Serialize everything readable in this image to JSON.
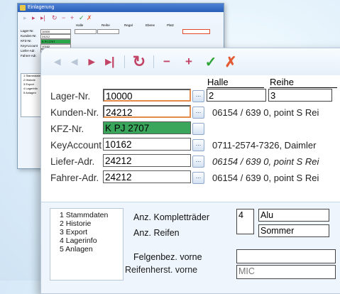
{
  "back_window": {
    "title": "Einlagerung",
    "column_headers": [
      "Halle",
      "Reihe",
      "Regal",
      "Ebene",
      "Platz"
    ],
    "labels": [
      "Lager-Nr.",
      "Kunden-Nr.",
      "KFZ-Nr.",
      "KeyAccount",
      "Liefer-Adr.",
      "Fahrer-Adr."
    ],
    "values": [
      "10000",
      "24212",
      "K PJ 2707",
      "10162",
      "24212",
      "24212"
    ],
    "nav": [
      "1 Stammdaten",
      "2 Historie",
      "3 Export",
      "4 Lagerinfo",
      "5 Anlagen"
    ]
  },
  "toolbar": {
    "icons": [
      "first-icon",
      "prev-icon",
      "next-icon",
      "last-icon",
      "refresh-icon",
      "delete-icon",
      "add-icon",
      "save-icon",
      "cancel-icon"
    ]
  },
  "form": {
    "headers": {
      "halle": "Halle",
      "reihe": "Reihe"
    },
    "rows": [
      {
        "label": "Lager-Nr.",
        "value": "10000",
        "info": ""
      },
      {
        "label": "Kunden-Nr.",
        "value": "24212",
        "info": "06154 / 639 0, point S Rei"
      },
      {
        "label": "KFZ-Nr.",
        "value": "K PJ 2707",
        "info": ""
      },
      {
        "label": "KeyAccount",
        "value": "10162",
        "info": "0711-2574-7326, Daimler"
      },
      {
        "label": "Liefer-Adr.",
        "value": "24212",
        "info": "06154 / 639 0, point S Rei"
      },
      {
        "label": "Fahrer-Adr.",
        "value": "24212",
        "info": "06154 / 639 0, point S Rei"
      }
    ],
    "halle_value": "2",
    "reihe_value": "3",
    "lookup_glyph": "..."
  },
  "bottom": {
    "nav": [
      "1 Stammdaten",
      "2 Historie",
      "3 Export",
      "4 Lagerinfo",
      "5 Anlagen"
    ],
    "anz_kompletteraeder_label": "Anz. Kompletträder",
    "anz_kompletteraeder_value": "4",
    "material": "Alu",
    "anz_reifen_label": "Anz. Reifen",
    "saison": "Sommer",
    "felgenbez_label": "Felgenbez. vorne",
    "reifenherst_label": "Reifenherst. vorne",
    "reifenherst_value": "MIC"
  }
}
